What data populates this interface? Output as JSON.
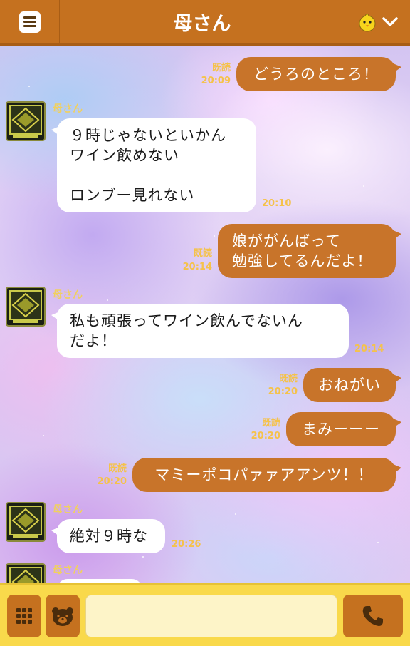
{
  "header": {
    "title": "母さん",
    "menu_icon": "menu-icon",
    "right_icons": [
      "chick-icon",
      "chevron-down-icon"
    ]
  },
  "colors": {
    "header_bg": "#c5711f",
    "outgoing_bubble": "#c8742a",
    "incoming_bubble": "#ffffff",
    "timestamp": "#f5c24a",
    "input_bar": "#f9d94b"
  },
  "messages": [
    {
      "direction": "out",
      "text": "どうろのところ！",
      "read_label": "既読",
      "time": "20:09"
    },
    {
      "direction": "in",
      "sender": "母さん",
      "text": "９時じゃないといかん\nワイン飲めない\n\nロンブー見れない",
      "time": "20:10"
    },
    {
      "direction": "out",
      "text": "娘ががんばって\n勉強してるんだよ！",
      "read_label": "既読",
      "time": "20:14"
    },
    {
      "direction": "in",
      "sender": "母さん",
      "text": "私も頑張ってワイン飲んでないん\nだよ！",
      "time": "20:14"
    },
    {
      "direction": "out",
      "text": "おねがい",
      "read_label": "既読",
      "time": "20:20"
    },
    {
      "direction": "out",
      "text": "まみーーー",
      "read_label": "既読",
      "time": "20:20"
    },
    {
      "direction": "out",
      "text": "マミーポコパァァアアンツ！！",
      "read_label": "既読",
      "time": "20:20"
    },
    {
      "direction": "in",
      "sender": "母さん",
      "text": "絶対９時な",
      "time": "20:26"
    },
    {
      "direction": "in",
      "sender": "母さん",
      "text": "",
      "time": ""
    }
  ],
  "input_bar": {
    "buttons": [
      "keyboard-grid-icon",
      "bear-icon",
      "phone-icon"
    ],
    "message_value": "",
    "message_placeholder": ""
  }
}
